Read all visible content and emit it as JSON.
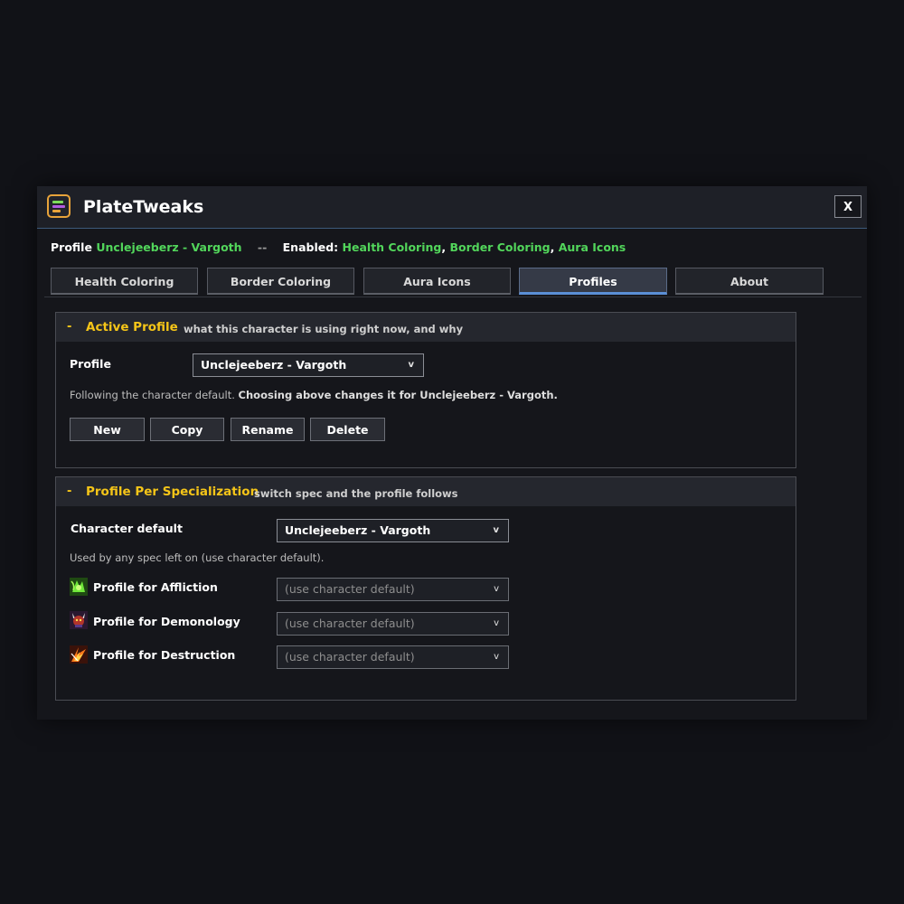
{
  "window": {
    "title": "PlateTweaks",
    "close_label": "X"
  },
  "status": {
    "profile_label": "Profile",
    "profile_name": "Unclejeeberz - Vargoth",
    "separator": "--",
    "enabled_label": "Enabled:",
    "enabled_modules": [
      "Health Coloring",
      "Border Coloring",
      "Aura Icons"
    ]
  },
  "tabs": [
    {
      "label": "Health Coloring",
      "active": false
    },
    {
      "label": "Border Coloring",
      "active": false
    },
    {
      "label": "Aura Icons",
      "active": false
    },
    {
      "label": "Profiles",
      "active": true
    },
    {
      "label": "About",
      "active": false
    }
  ],
  "active_profile": {
    "collapse_glyph": "-",
    "title": "Active Profile",
    "subtitle": "what this character is using right now, and why",
    "profile_label": "Profile",
    "profile_value": "Unclejeeberz - Vargoth",
    "hint_prefix": "Following the character default.",
    "hint_rest": "Choosing above changes it for Unclejeeberz - Vargoth.",
    "buttons": [
      "New",
      "Copy",
      "Rename",
      "Delete"
    ]
  },
  "per_spec": {
    "collapse_glyph": "-",
    "title": "Profile Per Specialization",
    "subtitle": "switch spec and the profile follows",
    "default_label": "Character default",
    "default_value": "Unclejeeberz - Vargoth",
    "default_hint": "Used by any spec left on (use character default).",
    "specs": [
      {
        "label": "Profile for Affliction",
        "value": "(use character default)",
        "icon": "affliction-icon"
      },
      {
        "label": "Profile for Demonology",
        "value": "(use character default)",
        "icon": "demonology-icon"
      },
      {
        "label": "Profile for Destruction",
        "value": "(use character default)",
        "icon": "destruction-icon"
      }
    ]
  },
  "dropdown_arrow": "v",
  "colors": {
    "accent_gold": "#f5c518",
    "enabled_green": "#52d65b",
    "tab_active": "#5b8fd6",
    "title_border": "#e8a33a"
  }
}
